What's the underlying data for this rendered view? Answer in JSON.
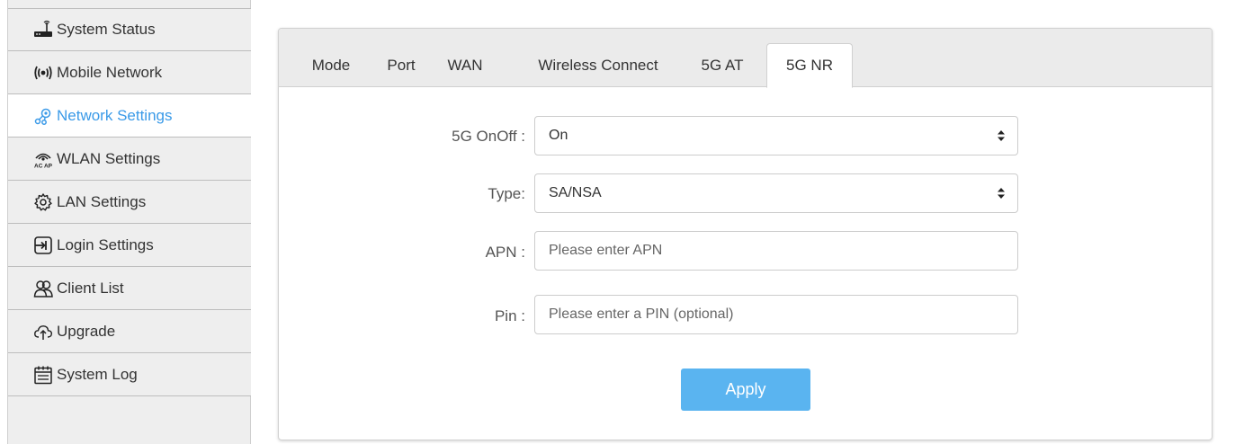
{
  "sidebar": {
    "items": [
      {
        "label": "System Status",
        "icon": "router-icon"
      },
      {
        "label": "Mobile Network",
        "icon": "signal-icon"
      },
      {
        "label": "Network Settings",
        "icon": "network-settings-icon",
        "active": true
      },
      {
        "label": "WLAN Settings",
        "icon": "wifi-acap-icon"
      },
      {
        "label": "LAN Settings",
        "icon": "gear-icon"
      },
      {
        "label": "Login Settings",
        "icon": "login-icon"
      },
      {
        "label": "Client List",
        "icon": "users-icon"
      },
      {
        "label": "Upgrade",
        "icon": "cloud-upload-icon"
      },
      {
        "label": "System Log",
        "icon": "calendar-log-icon"
      }
    ]
  },
  "tabs": [
    {
      "label": "Mode"
    },
    {
      "label": "Port"
    },
    {
      "label": "WAN"
    },
    {
      "label": "Wireless Connect"
    },
    {
      "label": "5G AT"
    },
    {
      "label": "5G NR",
      "active": true
    }
  ],
  "form": {
    "onoff_label": "5G OnOff :",
    "onoff_value": "On",
    "type_label": "Type:",
    "type_value": "SA/NSA",
    "apn_label": "APN :",
    "apn_placeholder": "Please enter APN",
    "pin_label": "Pin :",
    "pin_placeholder": "Please enter a PIN (optional)",
    "apply_label": "Apply"
  },
  "colors": {
    "accent": "#3a9ae8",
    "apply_button": "#5ab4f0",
    "sidebar_bg": "#eeeeee",
    "tabbar_bg": "#ebebeb"
  }
}
